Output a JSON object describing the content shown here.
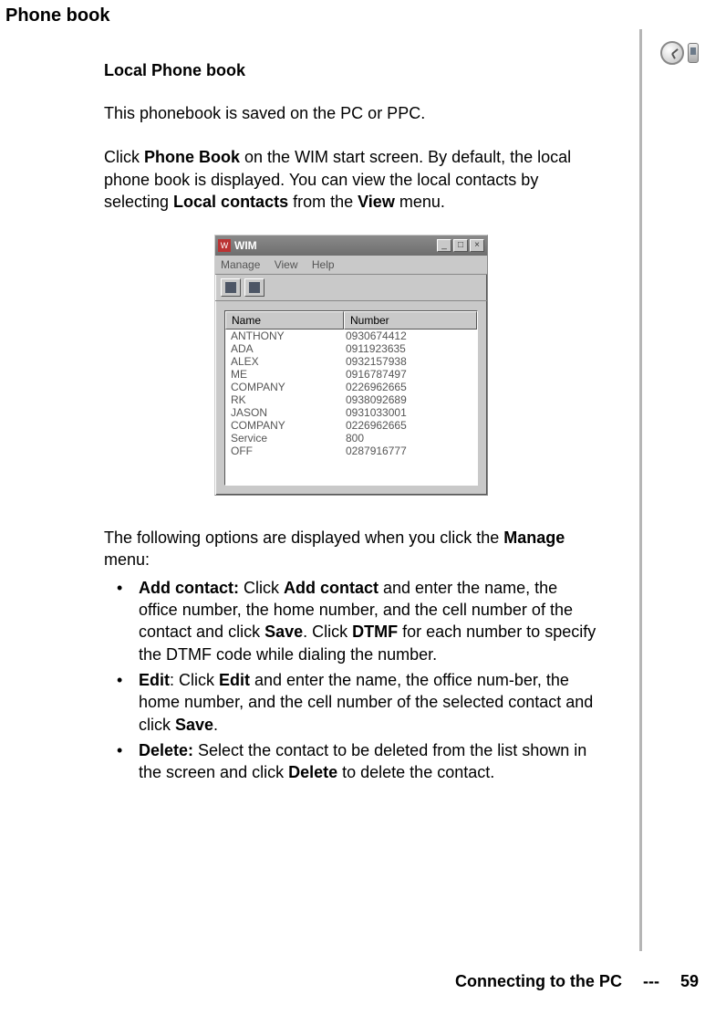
{
  "headings": {
    "h1": "Phone book",
    "h2": "Local Phone book"
  },
  "intro": "This phonebook is saved on the PC or PPC.",
  "desc": {
    "pre": "Click ",
    "b1": "Phone Book",
    "mid1": " on the WIM start screen. By default, the local phone book is displayed. You can view the local contacts by selecting ",
    "b2": "Local contacts",
    "mid2": " from the ",
    "b3": "View",
    "post": " menu."
  },
  "wim": {
    "title": "WIM",
    "menus": {
      "m1": "Manage",
      "m2": "View",
      "m3": "Help"
    },
    "columns": {
      "name": "Name",
      "number": "Number"
    },
    "rows": [
      {
        "name": "ANTHONY",
        "number": "0930674412"
      },
      {
        "name": "ADA",
        "number": "0911923635"
      },
      {
        "name": "ALEX",
        "number": "0932157938"
      },
      {
        "name": "ME",
        "number": "0916787497"
      },
      {
        "name": "COMPANY",
        "number": "0226962665"
      },
      {
        "name": "RK",
        "number": "0938092689"
      },
      {
        "name": "JASON",
        "number": "0931033001"
      },
      {
        "name": "COMPANY",
        "number": "0226962665"
      },
      {
        "name": "Service",
        "number": "800"
      },
      {
        "name": "OFF",
        "number": "0287916777"
      }
    ]
  },
  "options_intro": {
    "pre": "The following options are displayed when you click the ",
    "b": "Manage",
    "post": " menu:"
  },
  "options": {
    "add": {
      "label": "Add contact:",
      "t1": " Click ",
      "b1": "Add contact",
      "t2": " and enter the name, the office number, the home number, and the cell number of the contact and click ",
      "b2": "Save",
      "t3": ". Click ",
      "b3": "DTMF",
      "t4": " for each number to specify the DTMF code while dialing the number."
    },
    "edit": {
      "label": "Edit",
      "t1": ": Click ",
      "b1": "Edit",
      "t2": " and enter the name, the office num-ber, the home number, and the cell number of the selected contact and click ",
      "b2": "Save",
      "t3": "."
    },
    "delete": {
      "label": "Delete:",
      "t1": " Select the contact to be deleted from the list shown in the screen and click ",
      "b1": "Delete",
      "t2": " to delete the contact."
    }
  },
  "footer": {
    "text": "Connecting to the PC",
    "sep": "---",
    "page": "59"
  }
}
